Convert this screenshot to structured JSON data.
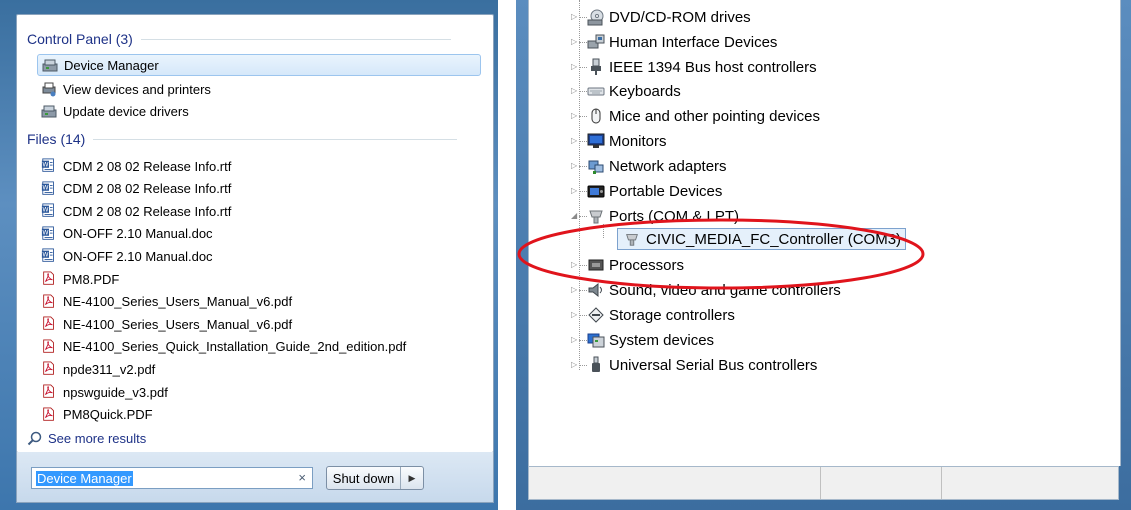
{
  "start_menu": {
    "control_panel_header": "Control Panel (3)",
    "control_panel_items": [
      {
        "label": "Device Manager",
        "icon": "device-manager-icon",
        "selected": true
      },
      {
        "label": "View devices and printers",
        "icon": "devices-printers-icon",
        "selected": false
      },
      {
        "label": "Update device drivers",
        "icon": "device-manager-icon",
        "selected": false
      }
    ],
    "files_header": "Files (14)",
    "files": [
      {
        "label": "CDM 2 08 02 Release Info.rtf",
        "icon": "word-doc-icon"
      },
      {
        "label": "CDM 2 08 02 Release Info.rtf",
        "icon": "word-doc-icon"
      },
      {
        "label": "CDM 2 08 02 Release Info.rtf",
        "icon": "word-doc-icon"
      },
      {
        "label": "ON-OFF 2.10 Manual.doc",
        "icon": "word-doc-icon"
      },
      {
        "label": "ON-OFF 2.10 Manual.doc",
        "icon": "word-doc-icon"
      },
      {
        "label": "PM8.PDF",
        "icon": "pdf-icon"
      },
      {
        "label": "NE-4100_Series_Users_Manual_v6.pdf",
        "icon": "pdf-icon"
      },
      {
        "label": "NE-4100_Series_Users_Manual_v6.pdf",
        "icon": "pdf-icon"
      },
      {
        "label": "NE-4100_Series_Quick_Installation_Guide_2nd_edition.pdf",
        "icon": "pdf-icon"
      },
      {
        "label": "npde311_v2.pdf",
        "icon": "pdf-icon"
      },
      {
        "label": "npswguide_v3.pdf",
        "icon": "pdf-icon"
      },
      {
        "label": "PM8Quick.PDF",
        "icon": "pdf-icon"
      }
    ],
    "see_more": "See more results",
    "search_value": "Device Manager",
    "search_clear": "×",
    "shutdown_label": "Shut down",
    "shutdown_arrow": "▶"
  },
  "device_manager": {
    "nodes": [
      {
        "label": "DVD/CD-ROM drives",
        "icon": "dvd-drive-icon"
      },
      {
        "label": "Human Interface Devices",
        "icon": "hid-icon"
      },
      {
        "label": "IEEE 1394 Bus host controllers",
        "icon": "firewire-icon"
      },
      {
        "label": "Keyboards",
        "icon": "keyboard-icon"
      },
      {
        "label": "Mice and other pointing devices",
        "icon": "mouse-icon"
      },
      {
        "label": "Monitors",
        "icon": "monitor-icon"
      },
      {
        "label": "Network adapters",
        "icon": "network-adapter-icon"
      },
      {
        "label": "Portable Devices",
        "icon": "portable-device-icon"
      },
      {
        "label": "Ports (COM & LPT)",
        "icon": "port-icon",
        "expanded": true
      },
      {
        "label": "Processors",
        "icon": "processor-icon"
      },
      {
        "label": "Sound, video and game controllers",
        "icon": "sound-icon"
      },
      {
        "label": "Storage controllers",
        "icon": "storage-icon"
      },
      {
        "label": "System devices",
        "icon": "system-device-icon"
      },
      {
        "label": "Universal Serial Bus controllers",
        "icon": "usb-icon"
      }
    ],
    "expanded_child": {
      "label": "CIVIC_MEDIA_FC_Controller (COM3)",
      "icon": "port-icon"
    }
  },
  "colors": {
    "annotation_ring": "#e0141c",
    "link_blue": "#1e3287",
    "selection_border": "#9cc5ee"
  }
}
